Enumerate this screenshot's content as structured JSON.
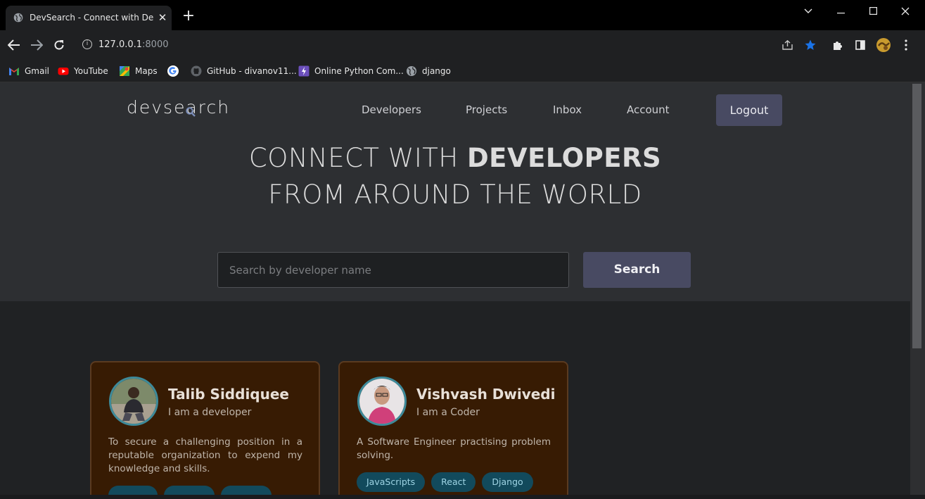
{
  "browser": {
    "tab_title": "DevSearch - Connect with Develc",
    "tab_close": "✕",
    "new_tab": "+",
    "url_host": "127.0.0.1",
    "url_port": ":8000",
    "bookmarks": [
      {
        "label": "Gmail",
        "icon": "gmail-icon"
      },
      {
        "label": "YouTube",
        "icon": "youtube-icon"
      },
      {
        "label": "Maps",
        "icon": "maps-icon"
      },
      {
        "label": "",
        "icon": "google-icon"
      },
      {
        "label": "GitHub - divanov11...",
        "icon": "github-icon"
      },
      {
        "label": "Online Python Com...",
        "icon": "python-compiler-icon"
      },
      {
        "label": "django",
        "icon": "globe-icon"
      }
    ]
  },
  "site": {
    "logo_text": "devsearch",
    "nav": [
      "Developers",
      "Projects",
      "Inbox",
      "Account"
    ],
    "logout_label": "Logout",
    "headline_line1_light": "CONNECT WITH ",
    "headline_line1_bold": "DEVELOPERS",
    "headline_line2": "FROM AROUND THE WORLD",
    "search_placeholder": "Search by developer name",
    "search_button": "Search"
  },
  "developers": [
    {
      "name": "Talib Siddiquee",
      "role": "I am a developer",
      "bio": "To secure a challenging position in a reputable organization to expend my knowledge and skills.",
      "tags": [
        "",
        "",
        ""
      ]
    },
    {
      "name": "Vishvash Dwivedi",
      "role": "I am a Coder",
      "bio": "A Software Engineer practising problem solving.",
      "tags": [
        "JavaScripts",
        "React",
        "Django"
      ]
    }
  ],
  "colors": {
    "hero_bg": "#2d2f32",
    "page_bg": "#202224",
    "button_bg": "#484a62",
    "card_bg": "#371b03",
    "tag_bg": "#124a5c"
  }
}
